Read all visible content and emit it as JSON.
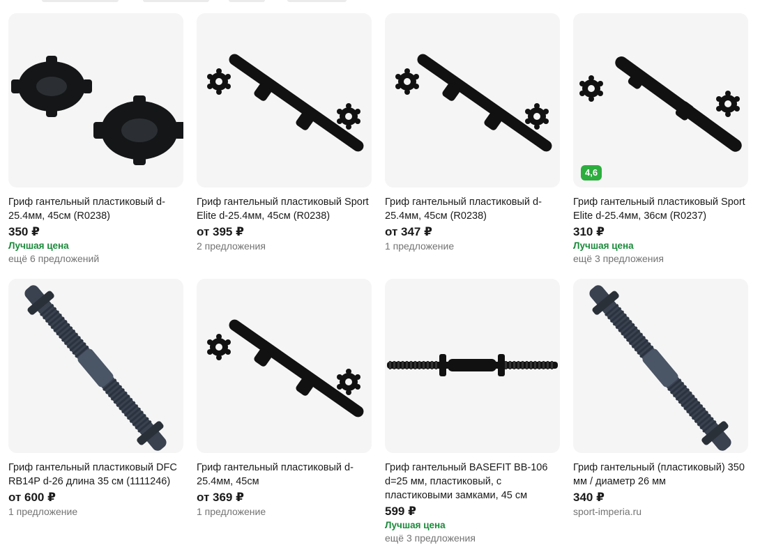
{
  "products": [
    {
      "title": "Гриф гантельный пластиковый d-25.4мм, 45см (R0238)",
      "price": "350 ₽",
      "best_price": "Лучшая цена",
      "offers": "ещё 6 предложений",
      "rating": null,
      "image": "collars"
    },
    {
      "title": "Гриф гантельный пластиковый Sport Elite d-25.4мм, 45см (R0238)",
      "price": "от 395 ₽",
      "best_price": null,
      "offers": "2 предложения",
      "rating": null,
      "image": "bar-with-nuts"
    },
    {
      "title": "Гриф гантельный пластиковый d-25.4мм, 45см (R0238)",
      "price": "от 347 ₽",
      "best_price": null,
      "offers": "1 предложение",
      "rating": null,
      "image": "bar-with-nuts"
    },
    {
      "title": "Гриф гантельный пластиковый Sport Elite d-25.4мм, 36см (R0237)",
      "price": "310 ₽",
      "best_price": "Лучшая цена",
      "offers": "ещё 3 предложения",
      "rating": "4,6",
      "image": "short-bar-with-nuts"
    },
    {
      "title": "Гриф гантельный пластиковый DFC RB14P d-26 длина 35 см (1111246)",
      "price": "от 600 ₽",
      "best_price": null,
      "offers": "1 предложение",
      "rating": null,
      "image": "threaded-bar-diagonal"
    },
    {
      "title": "Гриф гантельный пластиковый d-25.4мм, 45см",
      "price": "от 369 ₽",
      "best_price": null,
      "offers": "1 предложение",
      "rating": null,
      "image": "bar-with-nuts"
    },
    {
      "title": "Гриф гантельный BASEFIT BB-106 d=25 мм, пластиковый, с пластиковыми замками, 45 см",
      "price": "599 ₽",
      "best_price": "Лучшая цена",
      "offers": "ещё 3 предложения",
      "rating": null,
      "image": "horizontal-bar"
    },
    {
      "title": "Гриф гантельный (пластиковый) 350 мм / диаметр 26 мм",
      "price": "340 ₽",
      "best_price": null,
      "offers": "sport-imperia.ru",
      "rating": null,
      "image": "threaded-bar-diagonal"
    }
  ],
  "colors": {
    "accent_green": "#2cad3e",
    "best_price_green": "#1a8a3a",
    "muted_text": "#737373",
    "card_bg": "#f5f5f5"
  }
}
